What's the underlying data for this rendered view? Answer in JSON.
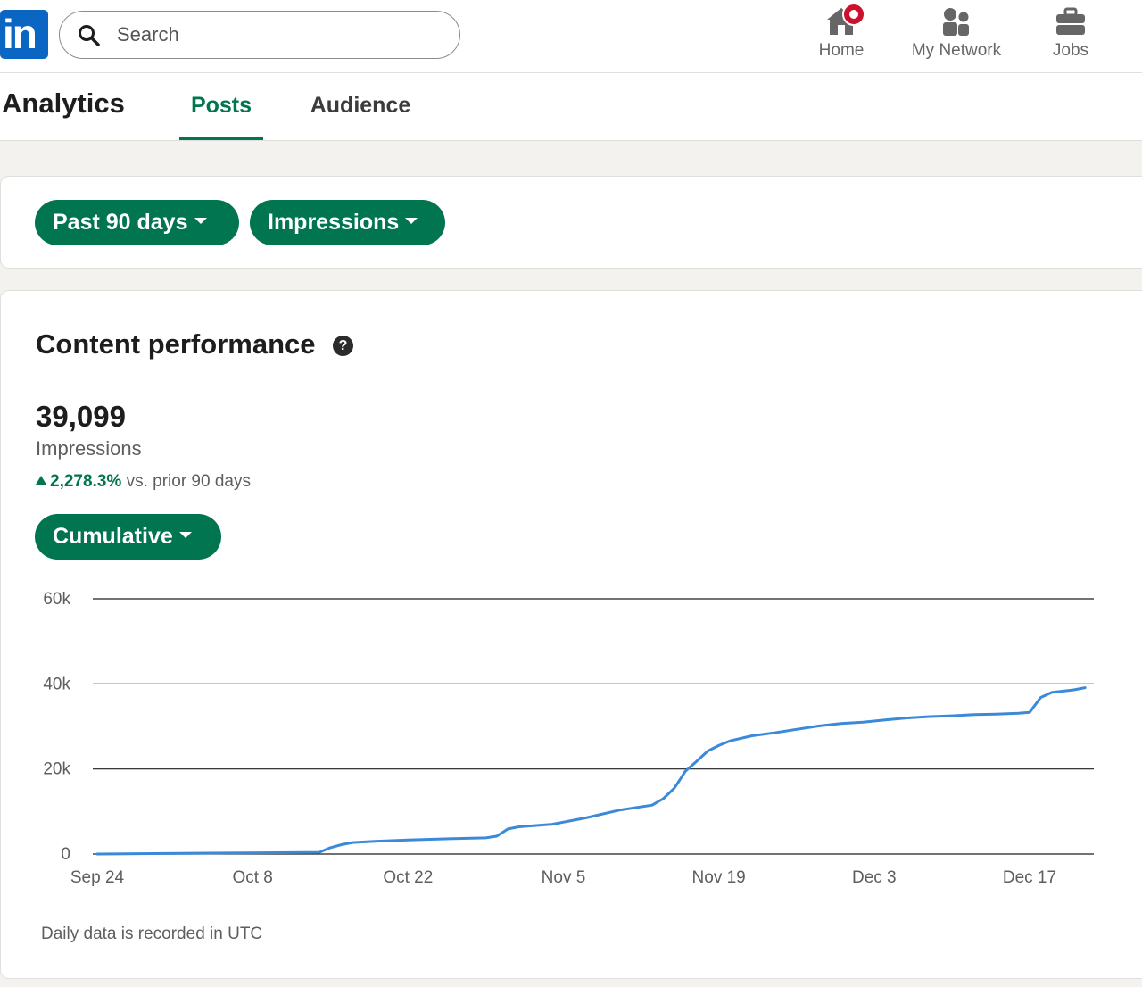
{
  "nav": {
    "logo_text": "in",
    "search_placeholder": "Search",
    "items": [
      {
        "label": "Home",
        "icon": "home-icon",
        "notification": true
      },
      {
        "label": "My Network",
        "icon": "people-icon"
      },
      {
        "label": "Jobs",
        "icon": "briefcase-icon"
      }
    ]
  },
  "analytics": {
    "title": "Analytics",
    "tabs": [
      {
        "label": "Posts",
        "active": true
      },
      {
        "label": "Audience",
        "active": false
      }
    ]
  },
  "filters": {
    "range": "Past 90 days",
    "metric": "Impressions"
  },
  "content": {
    "title": "Content performance",
    "help_icon": "question-icon",
    "total": "39,099",
    "total_label": "Impressions",
    "change_pct": "2,278.3%",
    "change_text": "vs. prior 90 days",
    "mode": "Cumulative",
    "footnote": "Daily data is recorded in UTC"
  },
  "colors": {
    "brand_blue": "#0a66c2",
    "accent_green": "#01754f",
    "line_blue": "#3b8ad9",
    "notification_red": "#cb112d"
  },
  "chart_data": {
    "type": "line",
    "title": "",
    "xlabel": "",
    "ylabel": "",
    "ylim": [
      0,
      60000
    ],
    "y_ticks": [
      {
        "value": 0,
        "label": "0"
      },
      {
        "value": 20000,
        "label": "20k"
      },
      {
        "value": 40000,
        "label": "40k"
      },
      {
        "value": 60000,
        "label": "60k"
      }
    ],
    "x_ticks": [
      {
        "day": 0,
        "label": "Sep 24"
      },
      {
        "day": 14,
        "label": "Oct 8"
      },
      {
        "day": 28,
        "label": "Oct 22"
      },
      {
        "day": 42,
        "label": "Nov 5"
      },
      {
        "day": 56,
        "label": "Nov 19"
      },
      {
        "day": 70,
        "label": "Dec 3"
      },
      {
        "day": 84,
        "label": "Dec 17"
      }
    ],
    "grid": true,
    "series": [
      {
        "values": [
          [
            0,
            0
          ],
          [
            5,
            100
          ],
          [
            10,
            200
          ],
          [
            15,
            300
          ],
          [
            20,
            400
          ],
          [
            21,
            1500
          ],
          [
            22,
            2200
          ],
          [
            23,
            2700
          ],
          [
            25,
            3000
          ],
          [
            28,
            3300
          ],
          [
            32,
            3600
          ],
          [
            35,
            3800
          ],
          [
            36,
            4200
          ],
          [
            37,
            5900
          ],
          [
            38,
            6400
          ],
          [
            41,
            7000
          ],
          [
            44,
            8500
          ],
          [
            47,
            10300
          ],
          [
            50,
            11500
          ],
          [
            51,
            13000
          ],
          [
            52,
            15500
          ],
          [
            53,
            19500
          ],
          [
            54,
            21800
          ],
          [
            55,
            24200
          ],
          [
            56,
            25500
          ],
          [
            57,
            26600
          ],
          [
            59,
            27800
          ],
          [
            61,
            28500
          ],
          [
            63,
            29300
          ],
          [
            65,
            30100
          ],
          [
            67,
            30700
          ],
          [
            69,
            31000
          ],
          [
            71,
            31500
          ],
          [
            73,
            32000
          ],
          [
            75,
            32300
          ],
          [
            77,
            32500
          ],
          [
            79,
            32800
          ],
          [
            81,
            32900
          ],
          [
            83,
            33100
          ],
          [
            84,
            33300
          ],
          [
            85,
            36800
          ],
          [
            86,
            38000
          ],
          [
            88,
            38600
          ],
          [
            89,
            39099
          ]
        ]
      }
    ]
  }
}
